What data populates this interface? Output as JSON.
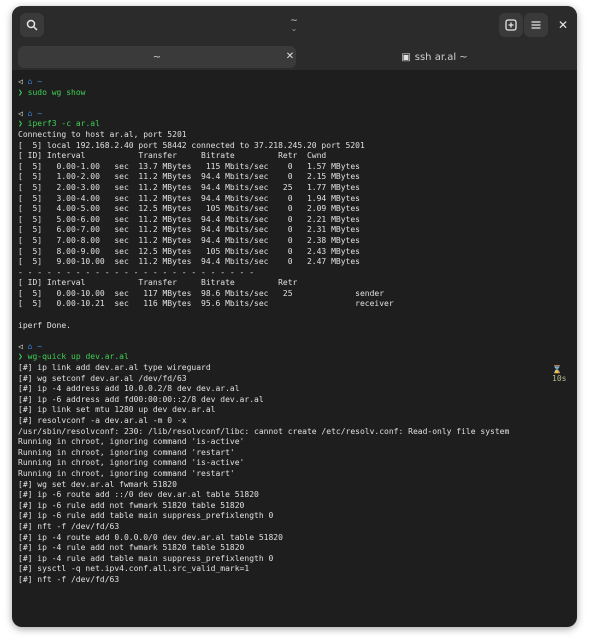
{
  "window": {
    "title": "~",
    "subtitle": "⌄",
    "buttons": {
      "search": "🔍",
      "new_tab": "⊞",
      "menu": "☰",
      "close": "✕"
    }
  },
  "tabs": [
    {
      "label": "~",
      "close": "✕"
    },
    {
      "label": "ssh ar.al ~",
      "icon": "▣"
    }
  ],
  "terminal": {
    "lines": [
      {
        "type": "prompt",
        "arrow": "◁",
        "home": "⌂ ~"
      },
      {
        "type": "cmd",
        "chevron": "❯",
        "text": "sudo wg show"
      },
      {
        "type": "blank"
      },
      {
        "type": "prompt",
        "arrow": "◁",
        "home": "⌂ ~"
      },
      {
        "type": "cmd",
        "chevron": "❯",
        "text": "iperf3 -c ar.al"
      },
      {
        "type": "out",
        "text": "Connecting to host ar.al, port 5201"
      },
      {
        "type": "out",
        "text": "[  5] local 192.168.2.40 port 58442 connected to 37.218.245.20 port 5201"
      },
      {
        "type": "out",
        "text": "[ ID] Interval           Transfer     Bitrate         Retr  Cwnd"
      },
      {
        "type": "out",
        "text": "[  5]   0.00-1.00   sec  13.7 MBytes   115 Mbits/sec    0   1.57 MBytes"
      },
      {
        "type": "out",
        "text": "[  5]   1.00-2.00   sec  11.2 MBytes  94.4 Mbits/sec    0   2.15 MBytes"
      },
      {
        "type": "out",
        "text": "[  5]   2.00-3.00   sec  11.2 MBytes  94.4 Mbits/sec   25   1.77 MBytes"
      },
      {
        "type": "out",
        "text": "[  5]   3.00-4.00   sec  11.2 MBytes  94.4 Mbits/sec    0   1.94 MBytes"
      },
      {
        "type": "out",
        "text": "[  5]   4.00-5.00   sec  12.5 MBytes   105 Mbits/sec    0   2.09 MBytes"
      },
      {
        "type": "out",
        "text": "[  5]   5.00-6.00   sec  11.2 MBytes  94.4 Mbits/sec    0   2.21 MBytes"
      },
      {
        "type": "out",
        "text": "[  5]   6.00-7.00   sec  11.2 MBytes  94.4 Mbits/sec    0   2.31 MBytes"
      },
      {
        "type": "out",
        "text": "[  5]   7.00-8.00   sec  11.2 MBytes  94.4 Mbits/sec    0   2.38 MBytes"
      },
      {
        "type": "out",
        "text": "[  5]   8.00-9.00   sec  12.5 MBytes   105 Mbits/sec    0   2.43 MBytes"
      },
      {
        "type": "out",
        "text": "[  5]   9.00-10.00  sec  11.2 MBytes  94.4 Mbits/sec    0   2.47 MBytes"
      },
      {
        "type": "out",
        "text": "- - - - - - - - - - - - - - - - - - - - - - - - -"
      },
      {
        "type": "out",
        "text": "[ ID] Interval           Transfer     Bitrate         Retr"
      },
      {
        "type": "out",
        "text": "[  5]   0.00-10.00  sec   117 MBytes  98.6 Mbits/sec   25             sender"
      },
      {
        "type": "out",
        "text": "[  5]   0.00-10.21  sec   116 MBytes  95.6 Mbits/sec                  receiver"
      },
      {
        "type": "blank"
      },
      {
        "type": "out",
        "text": "iperf Done."
      },
      {
        "type": "blank"
      },
      {
        "type": "prompt",
        "arrow": "◁",
        "home": "⌂ ~"
      },
      {
        "type": "cmd",
        "chevron": "❯",
        "text": "wg-quick up dev.ar.al"
      },
      {
        "type": "out",
        "text": "[#] ip link add dev.ar.al type wireguard"
      },
      {
        "type": "out",
        "text": "[#] wg setconf dev.ar.al /dev/fd/63"
      },
      {
        "type": "out",
        "text": "[#] ip -4 address add 10.0.0.2/8 dev dev.ar.al"
      },
      {
        "type": "out",
        "text": "[#] ip -6 address add fd00:00:00::2/8 dev dev.ar.al"
      },
      {
        "type": "out",
        "text": "[#] ip link set mtu 1280 up dev dev.ar.al"
      },
      {
        "type": "out",
        "text": "[#] resolvconf -a dev.ar.al -m 0 -x"
      },
      {
        "type": "out",
        "text": "/usr/sbin/resolvconf: 230: /lib/resolvconf/libc: cannot create /etc/resolv.conf: Read-only file system"
      },
      {
        "type": "out",
        "text": "Running in chroot, ignoring command 'is-active'"
      },
      {
        "type": "out",
        "text": "Running in chroot, ignoring command 'restart'"
      },
      {
        "type": "out",
        "text": "Running in chroot, ignoring command 'is-active'"
      },
      {
        "type": "out",
        "text": "Running in chroot, ignoring command 'restart'"
      },
      {
        "type": "out",
        "text": "[#] wg set dev.ar.al fwmark 51820"
      },
      {
        "type": "out",
        "text": "[#] ip -6 route add ::/0 dev dev.ar.al table 51820"
      },
      {
        "type": "out",
        "text": "[#] ip -6 rule add not fwmark 51820 table 51820"
      },
      {
        "type": "out",
        "text": "[#] ip -6 rule add table main suppress_prefixlength 0"
      },
      {
        "type": "out",
        "text": "[#] nft -f /dev/fd/63"
      },
      {
        "type": "out",
        "text": "[#] ip -4 route add 0.0.0.0/0 dev dev.ar.al table 51820"
      },
      {
        "type": "out",
        "text": "[#] ip -4 rule add not fwmark 51820 table 51820"
      },
      {
        "type": "out",
        "text": "[#] ip -4 rule add table main suppress_prefixlength 0"
      },
      {
        "type": "out",
        "text": "[#] sysctl -q net.ipv4.conf.all.src_valid_mark=1"
      },
      {
        "type": "out",
        "text": "[#] nft -f /dev/fd/63"
      }
    ],
    "timer": "⌛ 10s"
  },
  "colors": {
    "prompt_green": "#3fcf54",
    "home_blue": "#3b8eea",
    "background": "#1e1e1e"
  }
}
